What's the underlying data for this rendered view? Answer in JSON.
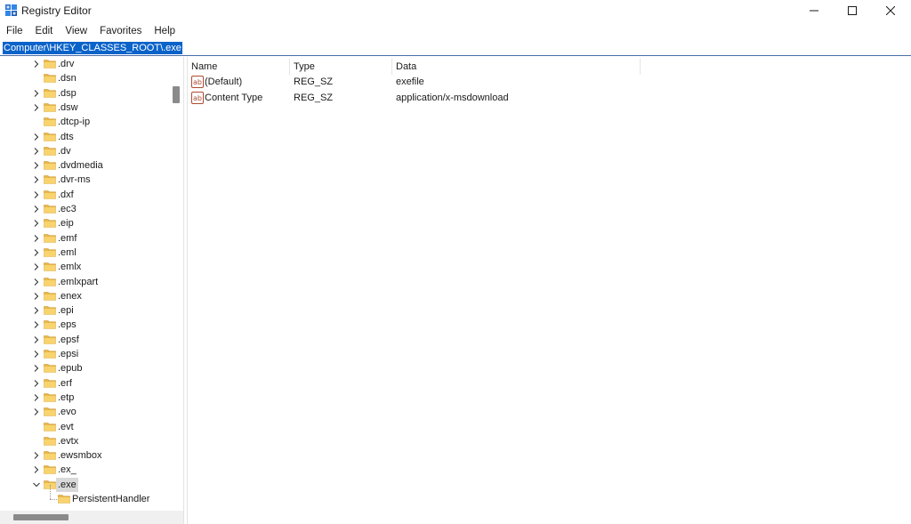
{
  "window": {
    "title": "Registry Editor",
    "accent_color": "#0a63c9"
  },
  "menu": {
    "items": [
      "File",
      "Edit",
      "View",
      "Favorites",
      "Help"
    ]
  },
  "address": {
    "path": "Computer\\HKEY_CLASSES_ROOT\\.exe"
  },
  "tree": {
    "items": [
      {
        "label": ".drv",
        "expandable": true
      },
      {
        "label": ".dsn",
        "expandable": false
      },
      {
        "label": ".dsp",
        "expandable": true
      },
      {
        "label": ".dsw",
        "expandable": true
      },
      {
        "label": ".dtcp-ip",
        "expandable": false
      },
      {
        "label": ".dts",
        "expandable": true
      },
      {
        "label": ".dv",
        "expandable": true
      },
      {
        "label": ".dvdmedia",
        "expandable": true
      },
      {
        "label": ".dvr-ms",
        "expandable": true
      },
      {
        "label": ".dxf",
        "expandable": true
      },
      {
        "label": ".ec3",
        "expandable": true
      },
      {
        "label": ".eip",
        "expandable": true
      },
      {
        "label": ".emf",
        "expandable": true
      },
      {
        "label": ".eml",
        "expandable": true
      },
      {
        "label": ".emlx",
        "expandable": true
      },
      {
        "label": ".emlxpart",
        "expandable": true
      },
      {
        "label": ".enex",
        "expandable": true
      },
      {
        "label": ".epi",
        "expandable": true
      },
      {
        "label": ".eps",
        "expandable": true
      },
      {
        "label": ".epsf",
        "expandable": true
      },
      {
        "label": ".epsi",
        "expandable": true
      },
      {
        "label": ".epub",
        "expandable": true
      },
      {
        "label": ".erf",
        "expandable": true
      },
      {
        "label": ".etp",
        "expandable": true
      },
      {
        "label": ".evo",
        "expandable": true
      },
      {
        "label": ".evt",
        "expandable": false
      },
      {
        "label": ".evtx",
        "expandable": false
      },
      {
        "label": ".ewsmbox",
        "expandable": true
      },
      {
        "label": ".ex_",
        "expandable": true
      },
      {
        "label": ".exe",
        "expandable": true,
        "expanded": true,
        "selected": true
      },
      {
        "label": "PersistentHandler",
        "expandable": false,
        "child": true
      }
    ]
  },
  "list": {
    "columns": [
      "Name",
      "Type",
      "Data"
    ],
    "rows": [
      {
        "name": "(Default)",
        "type": "REG_SZ",
        "data": "exefile",
        "icon": "string-value-icon"
      },
      {
        "name": "Content Type",
        "type": "REG_SZ",
        "data": "application/x-msdownload",
        "icon": "string-value-icon"
      }
    ]
  }
}
